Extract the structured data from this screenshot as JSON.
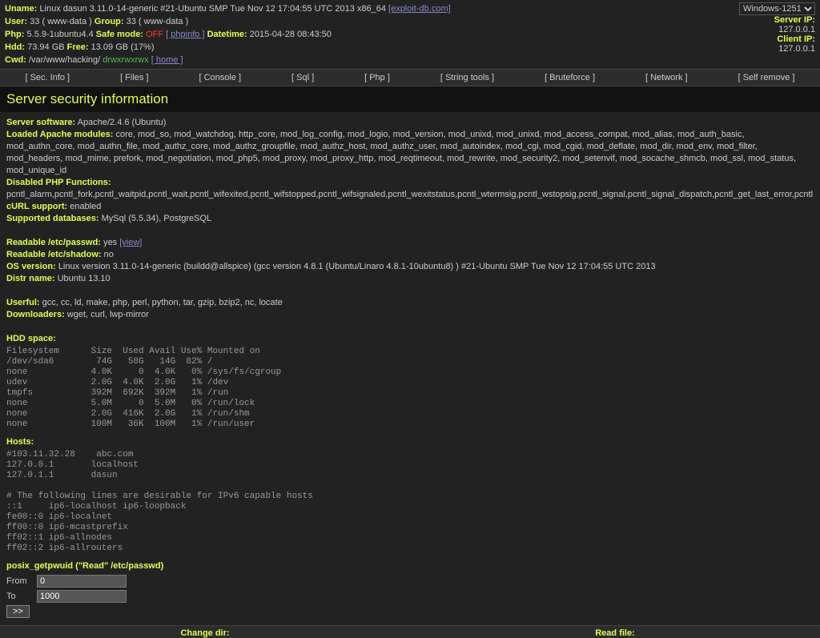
{
  "header": {
    "uname_label": "Uname:",
    "uname": "Linux dasun 3.11.0-14-generic #21-Ubuntu SMP Tue Nov 12 17:04:55 UTC 2013 x86_64",
    "exploit_link": "[exploit-db.com]",
    "user_label": "User:",
    "user": "33 ( www-data )",
    "group_label": "Group:",
    "group": "33 ( www-data )",
    "php_label": "Php:",
    "php": "5.5.9-1ubuntu4.4",
    "safemode_label": "Safe mode:",
    "safemode": "OFF",
    "phpinfo": "[ phpinfo ]",
    "datetime_label": "Datetime:",
    "datetime": "2015-04-28 08:43:50",
    "hdd_label": "Hdd:",
    "hdd_total": "73.94 GB",
    "free_label": "Free:",
    "hdd_free": "13.09 GB (17%)",
    "cwd_label": "Cwd:",
    "cwd": "/var/www/hacking/",
    "perms": "drwxrwxrwx",
    "home": "[ home ]",
    "encoding": "Windows-1251",
    "server_ip_label": "Server IP:",
    "server_ip": "127.0.0.1",
    "client_ip_label": "Client IP:",
    "client_ip": "127.0.0.1"
  },
  "nav": {
    "sec": "[ Sec. Info ]",
    "files": "[ Files ]",
    "console": "[ Console ]",
    "sql": "[ Sql ]",
    "php": "[ Php ]",
    "string": "[ String tools ]",
    "brute": "[ Bruteforce ]",
    "network": "[ Network ]",
    "selfremove": "[ Self remove ]"
  },
  "title": "Server security information",
  "info": {
    "software_label": "Server software:",
    "software": "Apache/2.4.6 (Ubuntu)",
    "modules_label": "Loaded Apache modules:",
    "modules": "core, mod_so, mod_watchdog, http_core, mod_log_config, mod_logio, mod_version, mod_unixd, mod_unixd, mod_access_compat, mod_alias, mod_auth_basic, mod_authn_core, mod_authn_file, mod_authz_core, mod_authz_groupfile, mod_authz_host, mod_authz_user, mod_autoindex, mod_cgi, mod_cgid, mod_deflate, mod_dir, mod_env, mod_filter, mod_headers, mod_mime, prefork, mod_negotiation, mod_php5, mod_proxy, mod_proxy_http, mod_reqtimeout, mod_rewrite, mod_security2, mod_setenvif, mod_socache_shmcb, mod_ssl, mod_status, mod_unique_id",
    "disabled_label": "Disabled PHP Functions:",
    "disabled": "pcntl_alarm,pcntl_fork,pcntl_waitpid,pcntl_wait,pcntl_wifexited,pcntl_wifstopped,pcntl_wifsignaled,pcntl_wexitstatus,pcntl_wtermsig,pcntl_wstopsig,pcntl_signal,pcntl_signal_dispatch,pcntl_get_last_error,pcntl",
    "curl_label": "cURL support:",
    "curl": "enabled",
    "db_label": "Supported databases:",
    "db": "MySql (5.5.34), PostgreSQL",
    "passwd_label": "Readable /etc/passwd:",
    "passwd": "yes",
    "view": "[view]",
    "shadow_label": "Readable /etc/shadow:",
    "shadow": "no",
    "os_label": "OS version:",
    "os": "Linux version 3.11.0-14-generic (buildd@allspice) (gcc version 4.8.1 (Ubuntu/Linaro 4.8.1-10ubuntu8) ) #21-Ubuntu SMP Tue Nov 12 17:04:55 UTC 2013",
    "distr_label": "Distr name:",
    "distr": "Ubuntu 13.10",
    "userful_label": "Userful:",
    "userful": "gcc, cc, ld, make, php, perl, python, tar, gzip, bzip2, nc, locate",
    "downloaders_label": "Downloaders:",
    "downloaders": "wget, curl, lwp-mirror",
    "hddspace_label": "HDD space:",
    "hddspace": "Filesystem      Size  Used Avail Use% Mounted on\n/dev/sda6        74G   58G   14G  82% /\nnone            4.0K     0  4.0K   0% /sys/fs/cgroup\nudev            2.0G  4.0K  2.0G   1% /dev\ntmpfs           392M  692K  392M   1% /run\nnone            5.0M     0  5.0M   0% /run/lock\nnone            2.0G  416K  2.0G   1% /run/shm\nnone            100M   36K  100M   1% /run/user",
    "hosts_label": "Hosts:",
    "hosts": "#103.11.32.28    abc.com\n127.0.0.1       localhost\n127.0.1.1       dasun\n\n# The following lines are desirable for IPv6 capable hosts\n::1     ip6-localhost ip6-loopback\nfe00::0 ip6-localnet\nff00::0 ip6-mcastprefix\nff02::1 ip6-allnodes\nff02::2 ip6-allrouters",
    "posix_label": "posix_getpwuid (\"Read\" /etc/passwd)",
    "from_label": "From",
    "from_val": "0",
    "to_label": "To",
    "to_val": "1000",
    "submit": ">>"
  },
  "footer": {
    "changedir": "Change dir:",
    "readfile": "Read file:"
  }
}
